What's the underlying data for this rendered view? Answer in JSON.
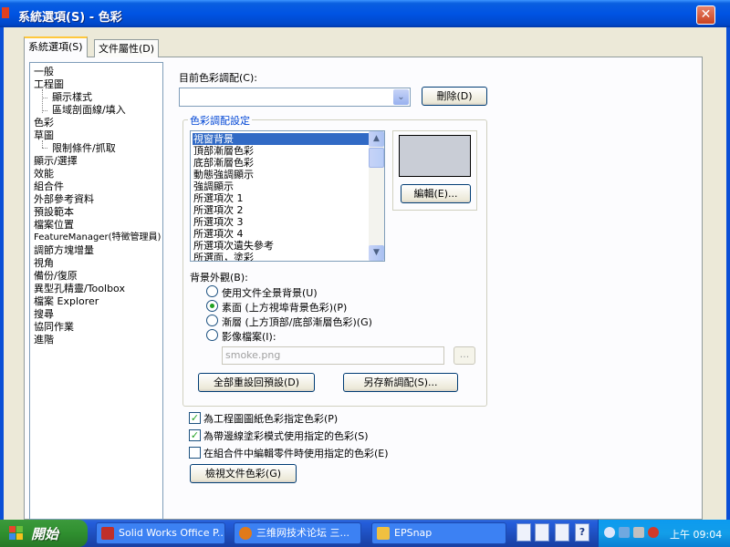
{
  "window": {
    "title": "系統選項(S) - 色彩",
    "close_glyph": "✕"
  },
  "tabs": [
    {
      "label": "系統選項(S)",
      "active": true
    },
    {
      "label": "文件屬性(D)",
      "active": false
    }
  ],
  "tree": {
    "items": [
      {
        "label": "一般",
        "level": 0
      },
      {
        "label": "工程圖",
        "level": 0
      },
      {
        "label": "顯示樣式",
        "level": 1
      },
      {
        "label": "區域剖面線/填入",
        "level": 1
      },
      {
        "label": "色彩",
        "level": 0
      },
      {
        "label": "草圖",
        "level": 0
      },
      {
        "label": "限制條件/抓取",
        "level": 1
      },
      {
        "label": "顯示/選擇",
        "level": 0
      },
      {
        "label": "效能",
        "level": 0
      },
      {
        "label": "組合件",
        "level": 0
      },
      {
        "label": "外部參考資料",
        "level": 0
      },
      {
        "label": "預設範本",
        "level": 0
      },
      {
        "label": "檔案位置",
        "level": 0
      },
      {
        "label": "FeatureManager(特徵管理員)",
        "level": 0
      },
      {
        "label": "調節方塊增量",
        "level": 0
      },
      {
        "label": "視角",
        "level": 0
      },
      {
        "label": "備份/復原",
        "level": 0
      },
      {
        "label": "異型孔精靈/Toolbox",
        "level": 0
      },
      {
        "label": "檔案 Explorer",
        "level": 0
      },
      {
        "label": "搜尋",
        "level": 0
      },
      {
        "label": "協同作業",
        "level": 0
      },
      {
        "label": "進階",
        "level": 0
      }
    ]
  },
  "scheme": {
    "label": "目前色彩調配(C):",
    "value": "",
    "delete_button": "刪除(D)",
    "dropdown_glyph": "⌄"
  },
  "color_settings": {
    "group_title": "色彩調配設定",
    "selected_index": 0,
    "items": [
      "視窗背景",
      "頂部漸層色彩",
      "底部漸層色彩",
      "動態強調顯示",
      "強調顯示",
      "所選項次 1",
      "所選項次 2",
      "所選項次 3",
      "所選項次 4",
      "所選項次遺失參考",
      "所選面，塗彩"
    ],
    "scroll_up": "▲",
    "scroll_down": "▼",
    "swatch_color": "#c9cdd6",
    "edit_button": "編輯(E)...",
    "background_label": "背景外觀(B):",
    "background_options": [
      {
        "label": "使用文件全景背景(U)",
        "checked": false
      },
      {
        "label": "素面 (上方視埠背景色彩)(P)",
        "checked": true
      },
      {
        "label": "漸層 (上方頂部/底部漸層色彩)(G)",
        "checked": false
      },
      {
        "label": "影像檔案(I):",
        "checked": false
      }
    ],
    "image_file": "smoke.png",
    "browse_button": "...",
    "reset_button": "全部重設回預設(D)",
    "save_as_button": "另存新調配(S)..."
  },
  "checkboxes": [
    {
      "label": "為工程圖圖紙色彩指定色彩(P)",
      "checked": true
    },
    {
      "label": "為帶邊線塗彩模式使用指定的色彩(S)",
      "checked": true
    },
    {
      "label": "在組合件中編輯零件時使用指定的色彩(E)",
      "checked": false
    }
  ],
  "check_glyph": "✓",
  "view_doc_colors_button": "檢視文件色彩(G)",
  "taskbar": {
    "start_label": "開始",
    "tasks": [
      {
        "label": "Solid Works Office P...",
        "icon_color": "#c0302a"
      },
      {
        "label": "三维网技术论坛 三...",
        "icon_color": "#e07a1a"
      },
      {
        "label": "EPSnap",
        "icon_color": "#f0c040"
      }
    ],
    "quick_launch": [
      "?",
      "?"
    ],
    "clock": "上午 09:04"
  }
}
